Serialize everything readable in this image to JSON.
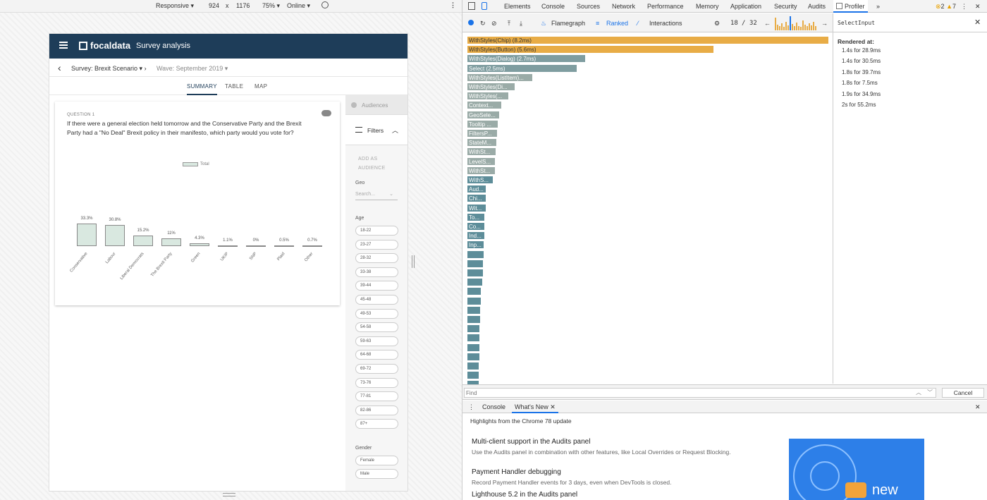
{
  "devbar": {
    "device": "Responsive ▾",
    "width": "924",
    "x": "x",
    "height": "1176",
    "zoom": "75% ▾",
    "network": "Online ▾"
  },
  "app": {
    "brand": "focaldata",
    "title": "Survey analysis",
    "survey": "Survey: Brexit Scenario",
    "wave": "Wave: September 2019",
    "tabs": [
      "SUMMARY",
      "TABLE",
      "MAP"
    ],
    "question_number": "QUESTION 1",
    "question_text": "If there were a general election held tomorrow and the Conservative Party and the Brexit Party had a \"No Deal\" Brexit policy in their manifesto, which party would you vote for?"
  },
  "chart_data": {
    "type": "bar",
    "categories": [
      "Conservative",
      "Labour",
      "Liberal Democrats",
      "The Brexit Party",
      "Green",
      "UKIP",
      "SNP",
      "Plaid",
      "Other"
    ],
    "series": [
      {
        "name": "Total",
        "values": [
          33.3,
          30.8,
          15.2,
          11,
          4.3,
          1.1,
          0,
          0.5,
          0.7
        ]
      }
    ],
    "value_labels": [
      "33.3%",
      "30.8%",
      "15.2%",
      "11%",
      "4.3%",
      "1.1%",
      "0%",
      "0.5%",
      "0.7%"
    ],
    "ylim": [
      0,
      35
    ]
  },
  "filters": {
    "audiences": "Audiences",
    "title": "Filters",
    "add_as_audience": "ADD AS AUDIENCE",
    "geo_label": "Geo",
    "geo_placeholder": "Search...",
    "age_label": "Age",
    "ages": [
      "18-22",
      "23-27",
      "28-32",
      "33-38",
      "39-44",
      "45-48",
      "49-53",
      "54-58",
      "59-63",
      "64-68",
      "69-72",
      "73-76",
      "77-81",
      "82-86",
      "87+"
    ],
    "gender_label": "Gender",
    "genders": [
      "Female",
      "Male"
    ]
  },
  "devtools": {
    "tabs": [
      "Elements",
      "Console",
      "Sources",
      "Network",
      "Performance",
      "Memory",
      "Application",
      "Security",
      "Audits",
      "Profiler"
    ],
    "more": "»",
    "errors": "2",
    "warnings": "7",
    "profiler": {
      "views": [
        "Flamegraph",
        "Ranked",
        "Interactions"
      ],
      "commit": "18",
      "commit_sep": "/",
      "commit_total": "32",
      "ranked": [
        {
          "label": "WithStyles(Chip) (8.2ms)",
          "value": 8.2
        },
        {
          "label": "WithStyles(Button) (5.6ms)",
          "value": 5.6
        },
        {
          "label": "WithStyles(Dialog) (2.7ms)",
          "value": 2.7
        },
        {
          "label": "Select (2.5ms)",
          "value": 2.5
        },
        {
          "label": "WithStyles(ListItem)...",
          "value": 1.5
        },
        {
          "label": "WithStyles(Di...",
          "value": 1.1
        },
        {
          "label": "WithStyles(...",
          "value": 0.95
        },
        {
          "label": "Context...",
          "value": 0.8
        },
        {
          "label": "GeoSele...",
          "value": 0.75
        },
        {
          "label": "Tooltip ...",
          "value": 0.72
        },
        {
          "label": "FiltersP...",
          "value": 0.7
        },
        {
          "label": "StateM...",
          "value": 0.68
        },
        {
          "label": "WithSt...",
          "value": 0.67
        },
        {
          "label": "LevelS...",
          "value": 0.66
        },
        {
          "label": "WithSt...",
          "value": 0.66
        },
        {
          "label": "WithS...",
          "value": 0.6
        },
        {
          "label": "Aud...",
          "value": 0.45
        },
        {
          "label": "Chi...",
          "value": 0.44
        },
        {
          "label": "Wit...",
          "value": 0.44
        },
        {
          "label": "To...",
          "value": 0.42
        },
        {
          "label": "Co...",
          "value": 0.41
        },
        {
          "label": "Ind...",
          "value": 0.41
        },
        {
          "label": "Inp...",
          "value": 0.4
        },
        {
          "label": "",
          "value": 0.4
        },
        {
          "label": "",
          "value": 0.39
        },
        {
          "label": "",
          "value": 0.38
        },
        {
          "label": "",
          "value": 0.36
        },
        {
          "label": "",
          "value": 0.33
        },
        {
          "label": "",
          "value": 0.33
        },
        {
          "label": "",
          "value": 0.32
        },
        {
          "label": "",
          "value": 0.32
        },
        {
          "label": "",
          "value": 0.31
        },
        {
          "label": "",
          "value": 0.31
        },
        {
          "label": "",
          "value": 0.3
        },
        {
          "label": "",
          "value": 0.3
        },
        {
          "label": "",
          "value": 0.29
        },
        {
          "label": "",
          "value": 0.29
        },
        {
          "label": "",
          "value": 0.28
        }
      ],
      "selected": "SelectInput",
      "rendered_at_label": "Rendered at:",
      "rendered_at": [
        "1.4s for 28.9ms",
        "1.4s for 30.5ms",
        "1.8s for 39.7ms",
        "1.8s for 7.5ms",
        "1.9s for 34.9ms",
        "2s for 55.2ms"
      ]
    },
    "find_placeholder": "Find",
    "cancel": "Cancel",
    "drawer": {
      "tabs": [
        "Console",
        "What's New"
      ],
      "highlights": "Highlights from the Chrome 78 update",
      "news": [
        {
          "title": "Multi-client support in the Audits panel",
          "desc": "Use the Audits panel in combination with other features, like Local Overrides or Request Blocking."
        },
        {
          "title": "Payment Handler debugging",
          "desc": "Record Payment Handler events for 3 days, even when DevTools is closed."
        },
        {
          "title": "Lighthouse 5.2 in the Audits panel",
          "desc": ""
        }
      ],
      "promo_text": "new"
    }
  },
  "colors": {
    "appbar": "#1e3d59",
    "bar_fill": "#d9e8e0",
    "hot": "#e8ac46",
    "cool": "#9aaba7",
    "accent": "#1a73e8"
  }
}
